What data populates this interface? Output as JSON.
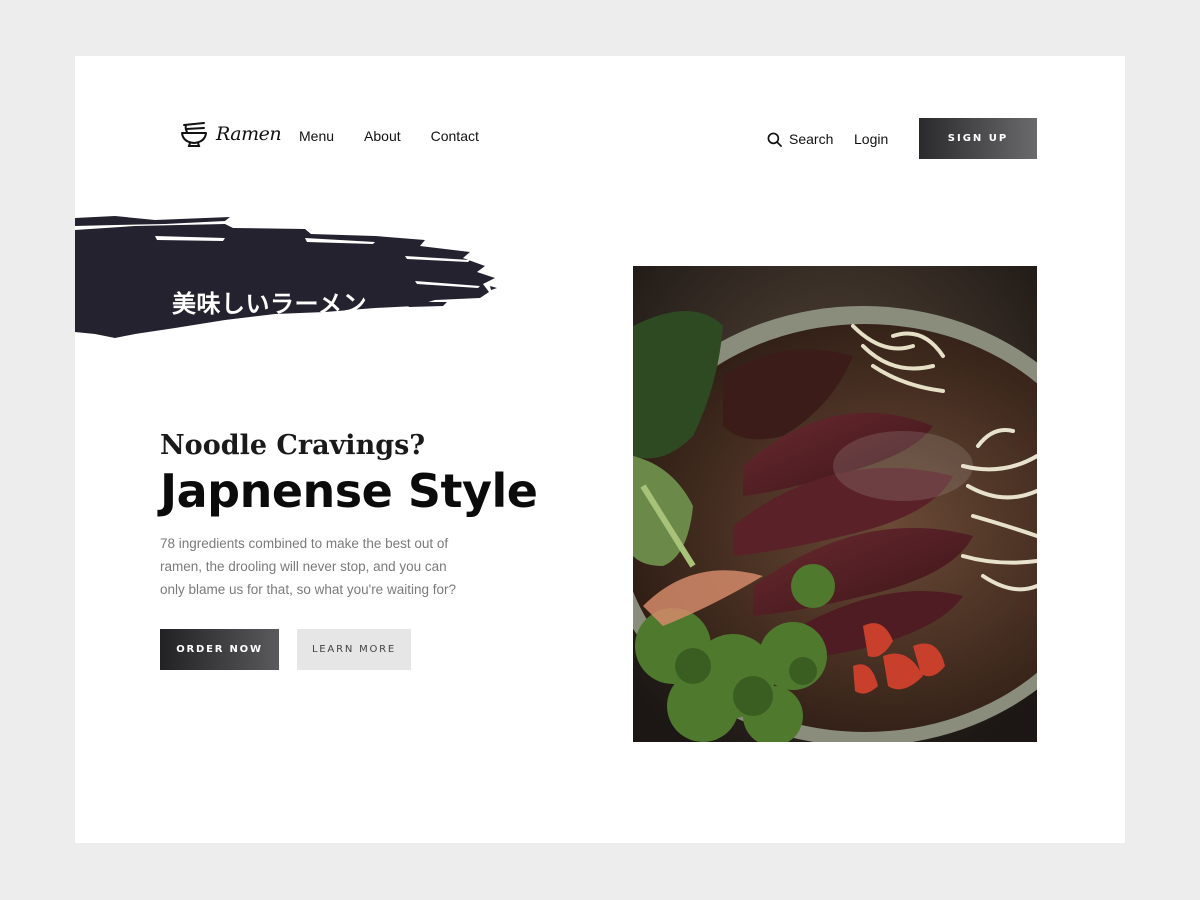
{
  "nav": {
    "logo_text": "Ramen",
    "links": [
      "Menu",
      "About",
      "Contact"
    ],
    "search_label": "Search",
    "login_label": "Login",
    "signup_label": "SIGN UP"
  },
  "hero": {
    "jp_title": "美味しいラーメン",
    "subtitle": "Noodle Cravings?",
    "headline": "Japnense Style",
    "description": "78 ingredients combined to make the best out of ramen, the drooling will never stop, and you can only blame us for that, so what you're waiting for?",
    "order_label": "ORDER NOW",
    "learn_label": "LEARN MORE"
  },
  "colors": {
    "background": "#eeedee",
    "card": "#ffffff",
    "brush": "#25222f",
    "dark_button": "#2a2a2c",
    "light_button": "#e6e6e6"
  }
}
